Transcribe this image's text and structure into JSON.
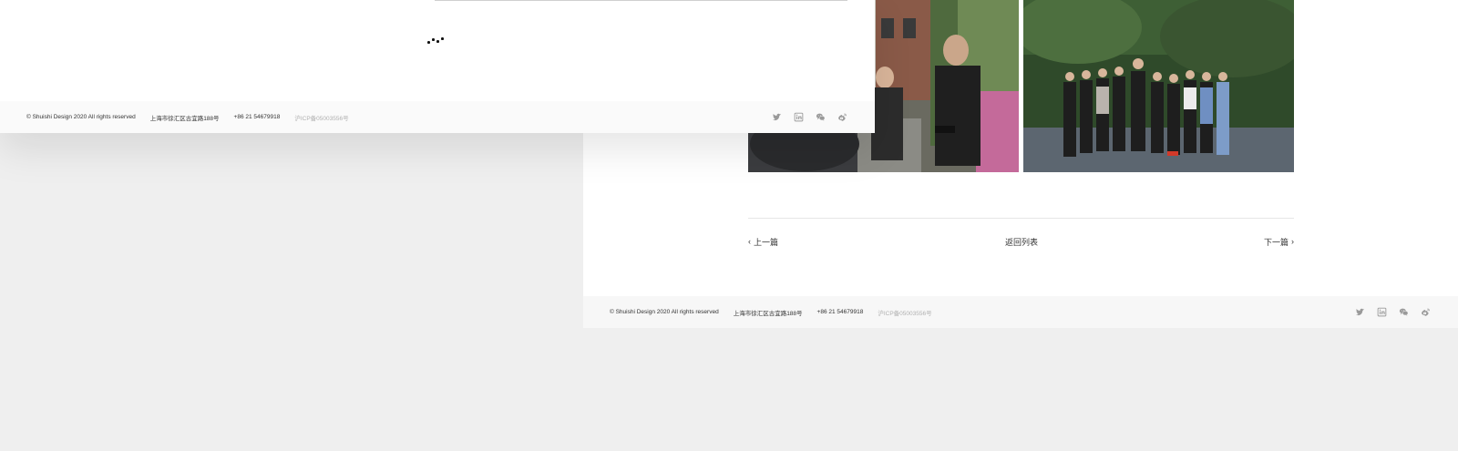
{
  "footer": {
    "copyright": "© Shuishi Design 2020 All rights reserved",
    "address": "上海市徐汇区古宜路188号",
    "phone": "+86 21 54679918",
    "icp": "沪ICP备05003556号"
  },
  "social_icons": [
    "twitter-icon",
    "linkedin-icon",
    "wechat-icon",
    "weibo-icon"
  ],
  "post_nav": {
    "prev": "上一篇",
    "list": "返回列表",
    "next": "下一篇"
  },
  "colors": {
    "page_background": "#efefef",
    "footer_background": "#f7f7f7",
    "icp_text": "#b0b0b0",
    "social_icon": "#9a9a9a"
  }
}
